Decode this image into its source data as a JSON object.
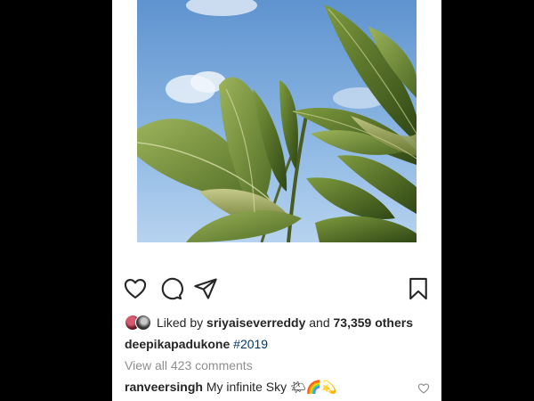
{
  "post": {
    "image_icon": "sky-leaves-photo",
    "liked_by_prefix": "Liked by",
    "liked_by_user": "sriyaiseverreddy",
    "liked_by_and": "and",
    "liked_by_others": "73,359 others",
    "author": "deepikapadukone",
    "caption_hashtag": "#2019",
    "view_comments": "View all 423 comments",
    "comment": {
      "user": "ranveersingh",
      "text": "My infinite Sky",
      "emojis": "🌤🌈💫"
    }
  },
  "actions": {
    "like_icon": "heart-icon",
    "comment_icon": "comment-bubble-icon",
    "share_icon": "paper-plane-icon",
    "save_icon": "bookmark-icon"
  },
  "colors": {
    "text": "#262626",
    "muted": "#8e8e8e",
    "hashtag": "#00376b",
    "background": "#000000",
    "card": "#ffffff"
  }
}
